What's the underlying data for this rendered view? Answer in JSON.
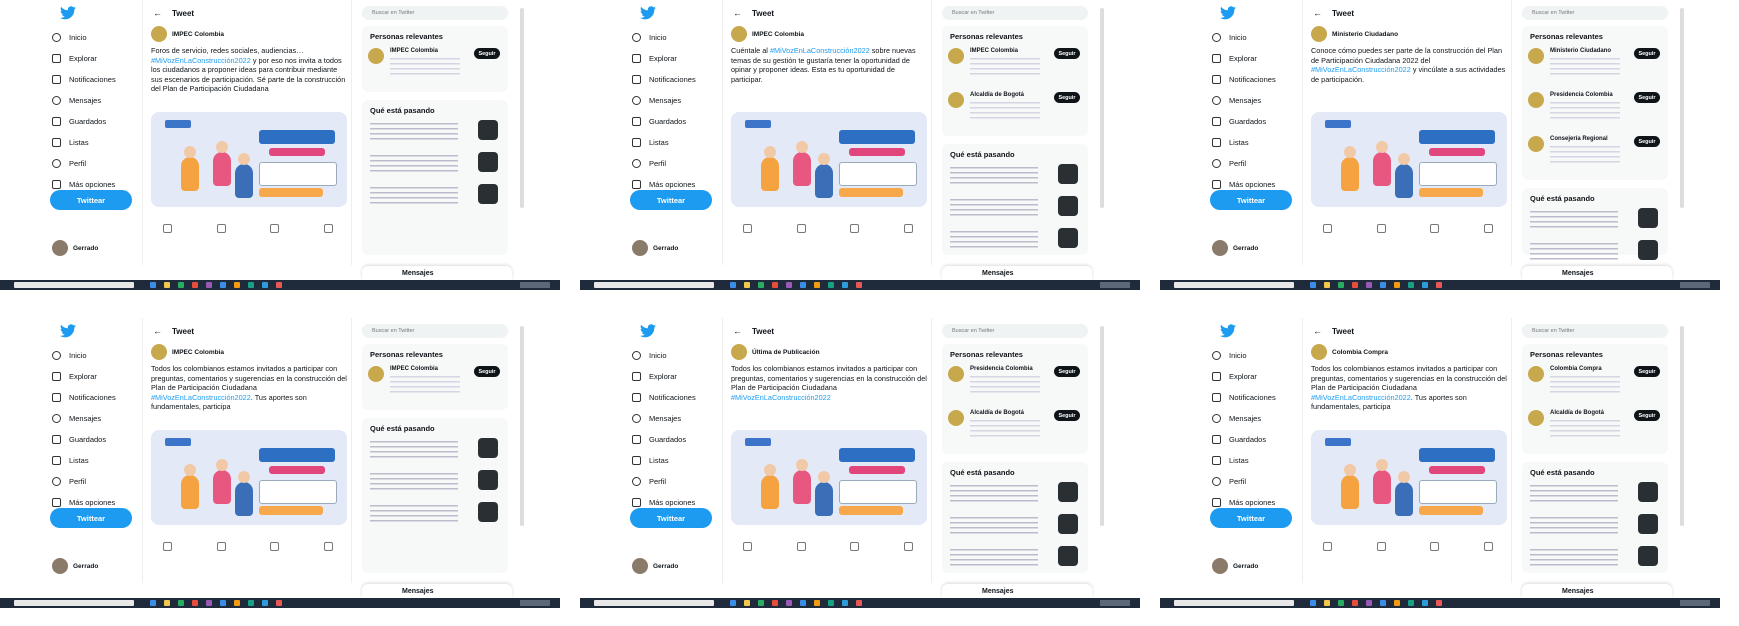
{
  "colors": {
    "accent": "#1d9bf0",
    "taskbar": "#1f2b3a",
    "text": "#0f1419"
  },
  "nav_items": [
    {
      "label": "Inicio",
      "icon": "home-icon"
    },
    {
      "label": "Explorar",
      "icon": "hash-icon"
    },
    {
      "label": "Notificaciones",
      "icon": "bell-icon"
    },
    {
      "label": "Mensajes",
      "icon": "mail-icon"
    },
    {
      "label": "Guardados",
      "icon": "bookmark-icon"
    },
    {
      "label": "Listas",
      "icon": "list-icon"
    },
    {
      "label": "Perfil",
      "icon": "person-icon"
    },
    {
      "label": "Más opciones",
      "icon": "more-icon"
    }
  ],
  "tweet_button": "Twittear",
  "account": {
    "name": "Gerrado",
    "handle": ""
  },
  "main_header": "Tweet",
  "sidebar_search": "Buscar en Twitter",
  "relevant_title": "Personas relevantes",
  "trends_title": "Qué está pasando",
  "follow_label": "Seguir",
  "messages_label": "Mensajes",
  "shots": [
    {
      "author": "IMPEC Colombia",
      "text_plain": "Foros de servicio, redes sociales, audiencias… ",
      "text_tag": "#MiVozEnLaConstrucción2022",
      "text_rest": " y por eso nos invita a todos los ciudadanos a proponer ideas para contribuir mediante sus escenarios de participación. Sé parte de la construcción del Plan de Participación Ciudadana",
      "persons": [
        "IMPEC Colombia"
      ]
    },
    {
      "author": "IMPEC Colombia",
      "text_plain": "Cuéntale al ",
      "text_tag": "#MiVozEnLaConstrucción2022",
      "text_rest": " sobre nuevas temas de su gestión te gustaría tener la oportunidad de opinar y proponer ideas. Esta es tu oportunidad de participar.",
      "persons": [
        "IMPEC Colombia",
        "Alcaldía de Bogotá"
      ]
    },
    {
      "author": "Ministerio Ciudadano",
      "text_plain": "Conoce cómo puedes ser parte de la construcción del Plan de Participación Ciudadana 2022 del ",
      "text_tag": "#MiVozEnLaConstrucción2022",
      "text_rest": " y vincúlate a sus actividades de participación.",
      "persons": [
        "Ministerio Ciudadano",
        "Presidencia Colombia",
        "Consejería Regional"
      ]
    },
    {
      "author": "IMPEC Colombia",
      "text_plain": "Todos los colombianos estamos invitados a participar con preguntas, comentarios y sugerencias en la construcción del Plan de Participación Ciudadana ",
      "text_tag": "#MiVozEnLaConstrucción2022",
      "text_rest": ". Tus aportes son fundamentales, participa",
      "persons": [
        "IMPEC Colombia"
      ]
    },
    {
      "author": "Última de Publicación",
      "text_plain": "Todos los colombianos estamos invitados a participar con preguntas, comentarios y sugerencias en la construcción del Plan de Participación Ciudadana ",
      "text_tag": "#MiVozEnLaConstrucción2022",
      "text_rest": "",
      "persons": [
        "Presidencia Colombia",
        "Alcaldía de Bogotá"
      ]
    },
    {
      "author": "Colombia Compra",
      "text_plain": "Todos los colombianos estamos invitados a participar con preguntas, comentarios y sugerencias en la construcción del Plan de Participación Ciudadana ",
      "text_tag": "#MiVozEnLaConstrucción2022",
      "text_rest": ". Tus aportes son fundamentales, participa",
      "persons": [
        "Colombia Compra",
        "Alcaldía de Bogotá"
      ]
    }
  ]
}
